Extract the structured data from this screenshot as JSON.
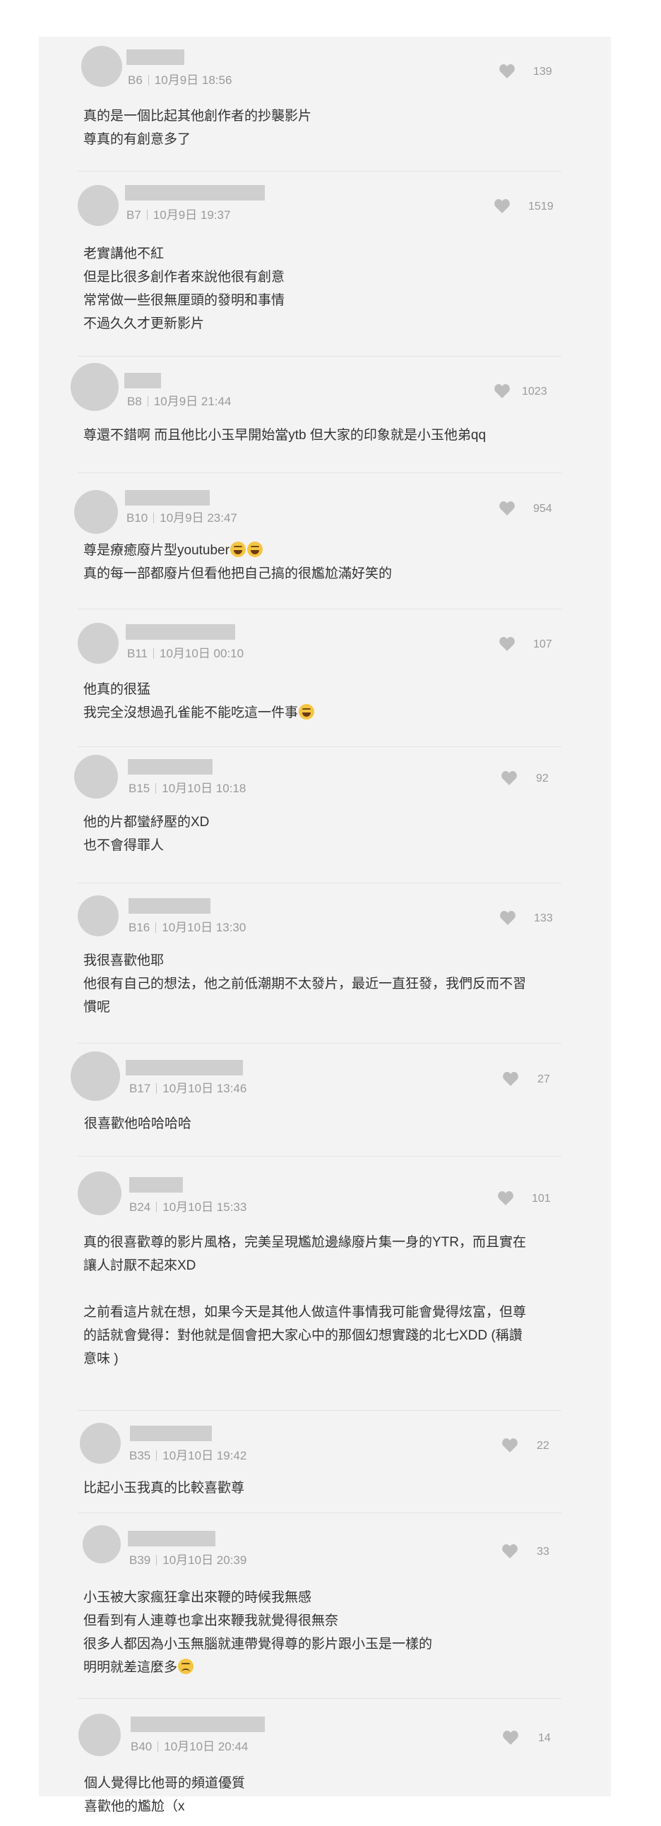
{
  "colors": {
    "panel": "#f3f3f3",
    "text": "#333333",
    "muted": "#9a9a9a",
    "placeholder": "#cfcfcf"
  },
  "comments": [
    {
      "floor": "B6",
      "date": "10月9日 18:56",
      "likes": "139",
      "lines": [
        "真的是一個比起其他創作者的抄襲影片",
        "尊真的有創意多了"
      ]
    },
    {
      "floor": "B7",
      "date": "10月9日 19:37",
      "likes": "1519",
      "lines": [
        "老實講他不紅",
        "但是比很多創作者來說他很有創意",
        "常常做一些很無厘頭的發明和事情",
        "不過久久才更新影片"
      ]
    },
    {
      "floor": "B8",
      "date": "10月9日 21:44",
      "likes": "1023",
      "lines": [
        "尊還不錯啊 而且他比小玉早開始當ytb 但大家的印象就是小玉他弟qq"
      ]
    },
    {
      "floor": "B10",
      "date": "10月9日 23:47",
      "likes": "954",
      "lines": [
        "尊是療癒廢片型youtuber",
        "真的每一部都廢片但看他把自己搞的很尷尬滿好笑的"
      ]
    },
    {
      "floor": "B11",
      "date": "10月10日 00:10",
      "likes": "107",
      "lines": [
        "他真的很猛",
        "我完全沒想過孔雀能不能吃這一件事"
      ]
    },
    {
      "floor": "B15",
      "date": "10月10日 10:18",
      "likes": "92",
      "lines": [
        "他的片都蠻紓壓的XD",
        "也不會得罪人"
      ]
    },
    {
      "floor": "B16",
      "date": "10月10日 13:30",
      "likes": "133",
      "lines": [
        "我很喜歡他耶",
        "他很有自己的想法，他之前低潮期不太發片，最近一直狂發，我們反而不習",
        "慣呢"
      ]
    },
    {
      "floor": "B17",
      "date": "10月10日 13:46",
      "likes": "27",
      "lines": [
        "很喜歡他哈哈哈哈"
      ]
    },
    {
      "floor": "B24",
      "date": "10月10日 15:33",
      "likes": "101",
      "lines": [
        "真的很喜歡尊的影片風格，完美呈現尷尬邊緣廢片集一身的YTR，而且實在",
        "讓人討厭不起來XD",
        "",
        "之前看這片就在想，如果今天是其他人做這件事情我可能會覺得炫富，但尊",
        "的話就會覺得：對他就是個會把大家心中的那個幻想實踐的北七XDD (稱讚",
        "意味 )"
      ]
    },
    {
      "floor": "B35",
      "date": "10月10日 19:42",
      "likes": "22",
      "lines": [
        "比起小玉我真的比較喜歡尊"
      ]
    },
    {
      "floor": "B39",
      "date": "10月10日 20:39",
      "likes": "33",
      "lines": [
        "小玉被大家瘋狂拿出來鞭的時候我無感",
        "但看到有人連尊也拿出來鞭我就覺得很無奈",
        "很多人都因為小玉無腦就連帶覺得尊的影片跟小玉是一樣的",
        "明明就差這麼多"
      ]
    },
    {
      "floor": "B40",
      "date": "10月10日 20:44",
      "likes": "14",
      "lines": [
        "個人覺得比他哥的頻道優質",
        "喜歡他的尷尬（x"
      ]
    }
  ]
}
